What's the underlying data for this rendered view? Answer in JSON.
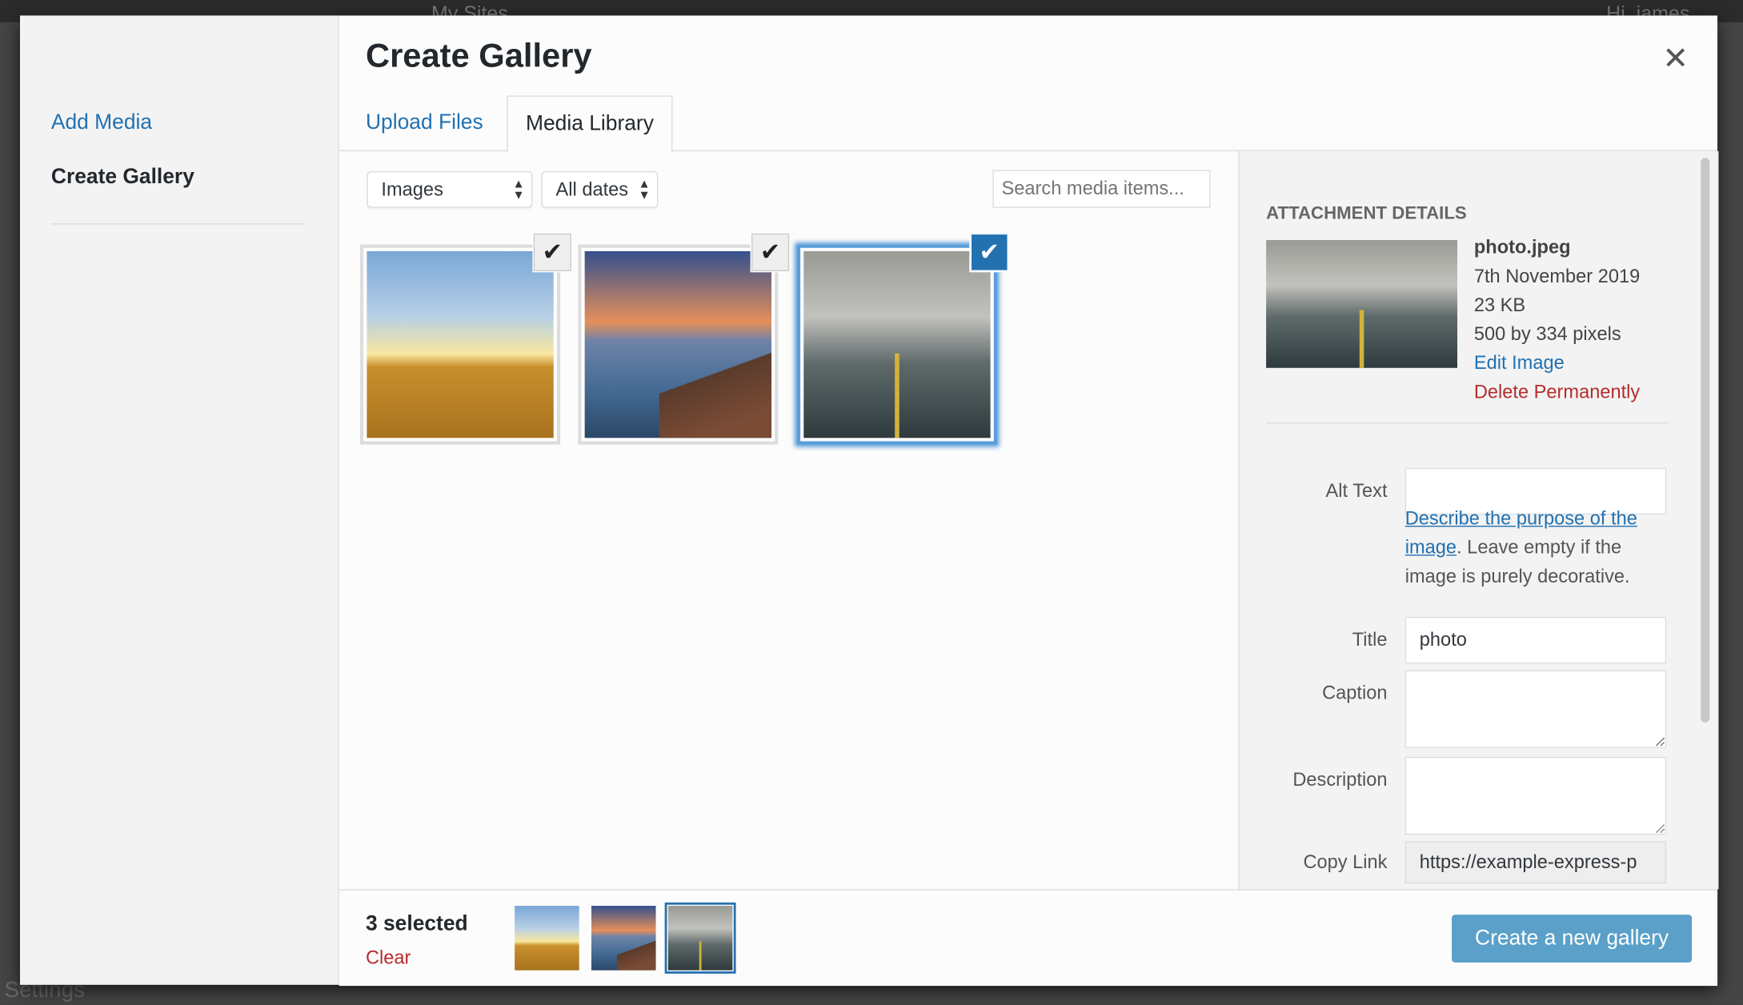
{
  "background": {
    "admin_bar": {
      "my_sites": "My Sites",
      "greeting": "Hi, james"
    },
    "settings_label": "Settings"
  },
  "menu": {
    "items": [
      {
        "label": "Add Media"
      },
      {
        "label": "Create Gallery"
      }
    ]
  },
  "header": {
    "title": "Create Gallery",
    "close_icon": "close-icon"
  },
  "tabs": [
    {
      "label": "Upload Files"
    },
    {
      "label": "Media Library",
      "active": true
    }
  ],
  "filters": {
    "type": "Images",
    "date": "All dates",
    "search_placeholder": "Search media items..."
  },
  "attachments": [
    {
      "name": "wheat field",
      "selected": true
    },
    {
      "name": "pier",
      "selected": true
    },
    {
      "name": "photo.jpeg",
      "selected": true,
      "active": true
    }
  ],
  "details": {
    "heading": "ATTACHMENT DETAILS",
    "filename": "photo.jpeg",
    "date": "7th November 2019",
    "size": "23 KB",
    "dimensions": "500 by 334 pixels",
    "edit": "Edit Image",
    "delete": "Delete Permanently",
    "alt_label": "Alt Text",
    "alt_value": "",
    "alt_help_link": "Describe the purpose of the image",
    "alt_help_text": ". Leave empty if the image is purely decorative.",
    "title_label": "Title",
    "title_value": "photo",
    "caption_label": "Caption",
    "caption_value": "",
    "description_label": "Description",
    "description_value": "",
    "copy_link_label": "Copy Link",
    "copy_link_value": "https://example-express-p"
  },
  "toolbar": {
    "count": "3 selected",
    "clear": "Clear",
    "create": "Create a new gallery"
  },
  "colors": {
    "accent": "#2271b1",
    "danger": "#b32d2e",
    "primary_button": "#5aa0c8"
  }
}
